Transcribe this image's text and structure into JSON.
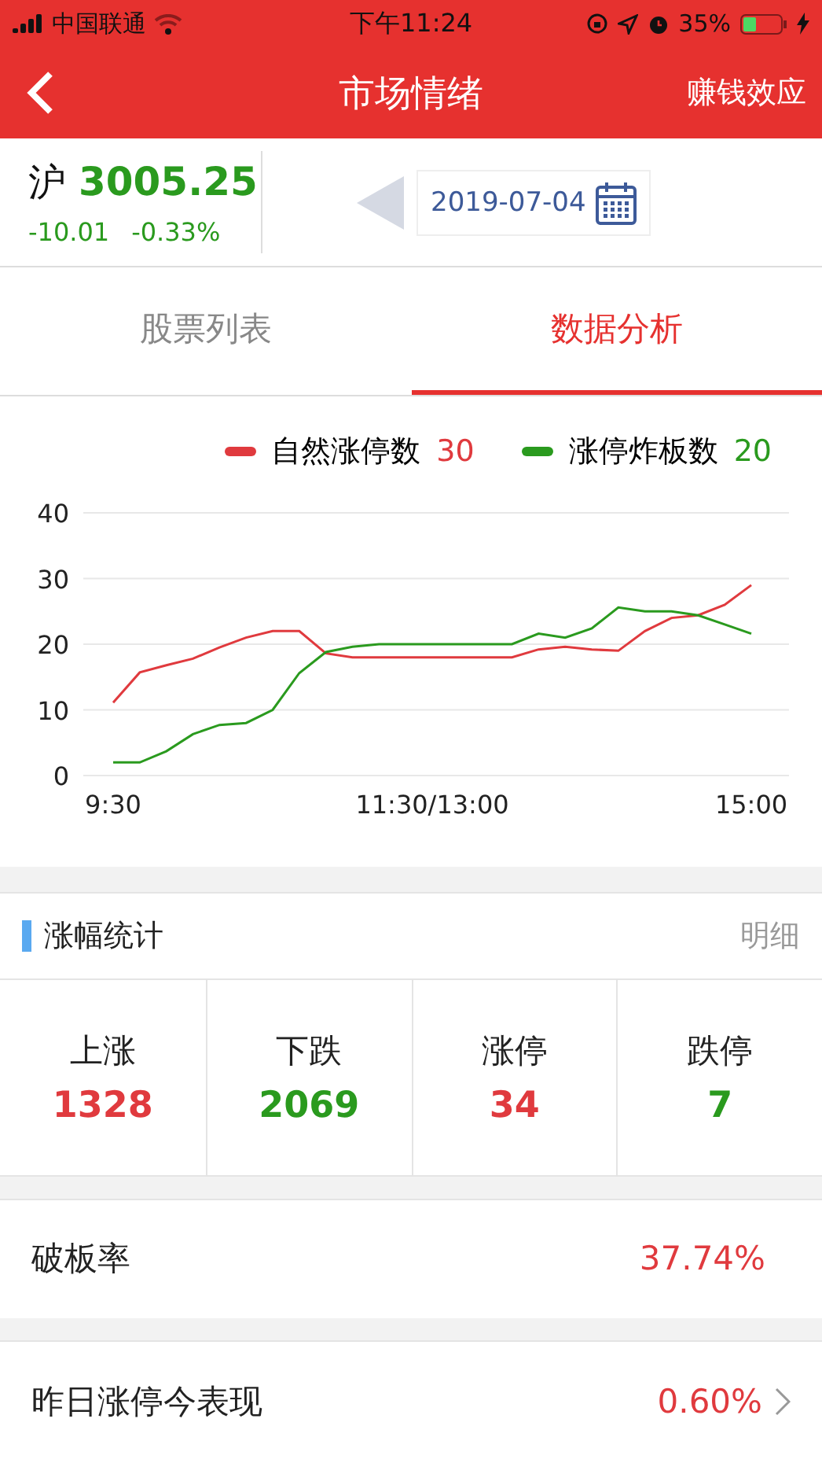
{
  "status_bar": {
    "carrier": "中国联通",
    "time": "下午11:24",
    "battery": "35%"
  },
  "nav": {
    "title": "市场情绪",
    "action": "赚钱效应"
  },
  "index": {
    "name": "沪",
    "value": "3005.25",
    "change": "-10.01",
    "percent": "-0.33%",
    "color": "#2a9a1e"
  },
  "date": {
    "value": "2019-07-04"
  },
  "tabs": [
    {
      "label": "股票列表",
      "selected": false
    },
    {
      "label": "数据分析",
      "selected": true
    }
  ],
  "chart": {
    "legend": [
      {
        "value": "30"
      },
      {
        "value": "20"
      }
    ],
    "chart_data": {
      "type": "line",
      "categories": [
        "9:30",
        null,
        null,
        null,
        null,
        null,
        null,
        null,
        null,
        null,
        null,
        null,
        "11:30/13:00",
        null,
        null,
        null,
        null,
        null,
        null,
        null,
        null,
        null,
        null,
        null,
        "15:00"
      ],
      "ylim": [
        0,
        40
      ],
      "yticks": [
        0,
        10,
        20,
        30,
        40
      ],
      "grid": true,
      "series": [
        {
          "name": "自然涨停数",
          "color": "#e03a3e",
          "values": [
            11.1,
            15.7,
            16.8,
            17.8,
            19.5,
            21,
            22,
            22,
            18.6,
            18,
            18,
            18,
            18,
            18,
            18,
            18,
            19.2,
            19.6,
            19.2,
            19,
            22,
            24,
            24.4,
            26,
            29
          ]
        },
        {
          "name": "涨停炸板数",
          "color": "#2a9a1e",
          "values": [
            2,
            2,
            3.7,
            6.3,
            7.7,
            8,
            10,
            15.6,
            18.8,
            19.6,
            20,
            20,
            20,
            20,
            20,
            20,
            21.6,
            21,
            22.4,
            25.6,
            25,
            25,
            24.4,
            23,
            21.6
          ]
        }
      ]
    }
  },
  "stats": {
    "title": "涨幅统计",
    "link": "明细",
    "items": [
      {
        "label": "上涨",
        "value": "1328",
        "color": "#e03a3e"
      },
      {
        "label": "下跌",
        "value": "2069",
        "color": "#2a9a1e"
      },
      {
        "label": "涨停",
        "value": "34",
        "color": "#e03a3e"
      },
      {
        "label": "跌停",
        "value": "7",
        "color": "#2a9a1e"
      }
    ]
  },
  "rows": [
    {
      "label": "破板率",
      "value": "37.74%",
      "chevron": false
    },
    {
      "label": "昨日涨停今表现",
      "value": "0.60%",
      "chevron": true
    }
  ]
}
